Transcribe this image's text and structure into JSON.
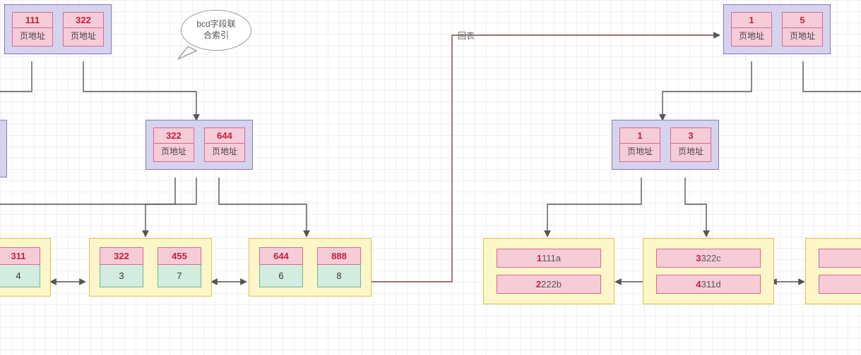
{
  "bubble_text": "bcd字段联合索引",
  "annot_back": "回表",
  "ptr_label": "页地址",
  "left": {
    "root": {
      "keys": [
        "111",
        "322"
      ]
    },
    "mid": {
      "keys": [
        "322",
        "644"
      ]
    },
    "leaves": [
      {
        "recs": [
          {
            "k": "311",
            "v": "4"
          }
        ]
      },
      {
        "recs": [
          {
            "k": "322",
            "v": "3"
          },
          {
            "k": "455",
            "v": "7"
          }
        ]
      },
      {
        "recs": [
          {
            "k": "644",
            "v": "6"
          },
          {
            "k": "888",
            "v": "8"
          }
        ]
      }
    ]
  },
  "right": {
    "root": {
      "keys": [
        "1",
        "5"
      ]
    },
    "mid": {
      "keys": [
        "1",
        "3"
      ]
    },
    "leaves": [
      {
        "rows": [
          {
            "b": "1",
            "t": "111a"
          },
          {
            "b": "2",
            "t": "222b"
          }
        ]
      },
      {
        "rows": [
          {
            "b": "3",
            "t": "322c"
          },
          {
            "b": "4",
            "t": "311d"
          }
        ]
      },
      {
        "rows": [
          {
            "b": "",
            "t": ""
          },
          {
            "b": "",
            "t": ""
          }
        ]
      }
    ]
  }
}
